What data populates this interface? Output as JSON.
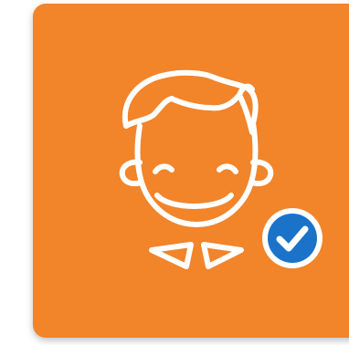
{
  "card": {
    "background_color": "#F2842A",
    "line_color": "#FFFFFF"
  },
  "avatar": {
    "icon": "boy-with-bow-tie-icon"
  },
  "verified_badge": {
    "icon": "checkmark-icon",
    "circle_color": "#1A73C8",
    "check_color": "#FFFFFF",
    "verified": true
  }
}
